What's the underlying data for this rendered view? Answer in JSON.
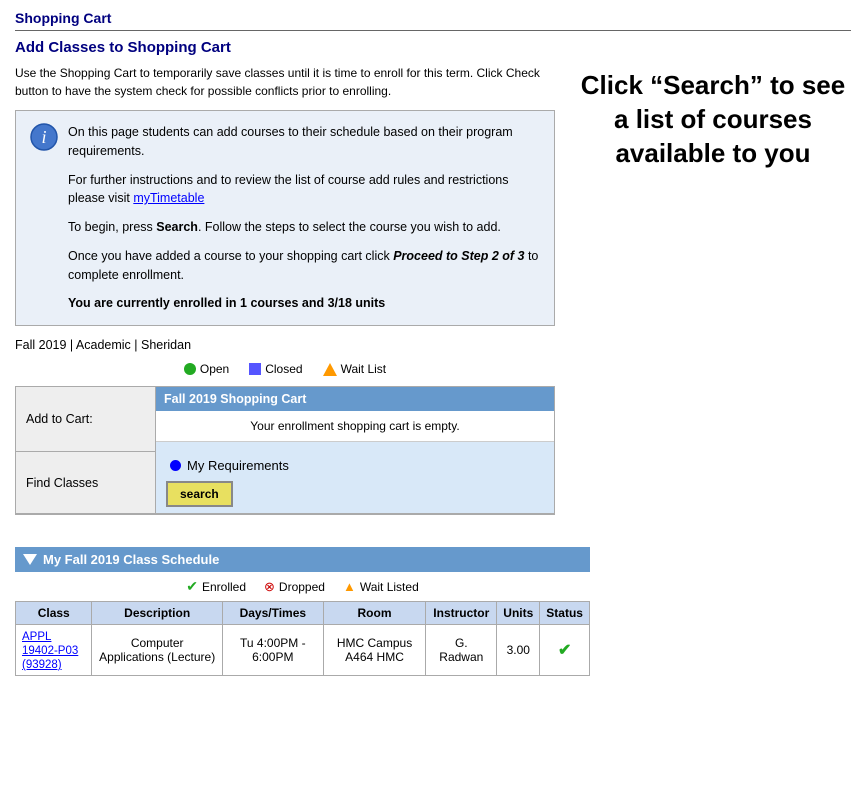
{
  "page": {
    "title": "Shopping Cart",
    "section_title": "Add Classes to Shopping Cart",
    "intro": "Use the Shopping Cart to temporarily save classes until it is time to enroll for this term.  Click Check button to have the system check for possible conflicts prior to enrolling.",
    "info_paragraphs": [
      "On this page students can add courses to their schedule based on their program requirements.",
      "For further instructions and to review the list of course add rules and restrictions please visit myTimetable",
      "To begin, press Search. Follow the steps to select the course you wish to add.",
      "Once you have added a course to your shopping cart click Proceed to Step 2 of 3 to complete enrollment.",
      "You are currently enrolled in 1 courses and 3/18 units"
    ],
    "my_timetable_link": "myTimetable",
    "callout_text": "Click “Search” to see a list of courses available to you"
  },
  "term": {
    "label": "Fall 2019 | Academic | Sheridan"
  },
  "legend": {
    "open_label": "Open",
    "closed_label": "Closed",
    "waitlist_label": "Wait List"
  },
  "cart": {
    "add_to_cart_label": "Add to Cart:",
    "find_classes_label": "Find Classes",
    "cart_title": "Fall 2019 Shopping Cart",
    "empty_message": "Your enrollment shopping cart is empty.",
    "my_requirements_label": "My Requirements",
    "search_button": "search"
  },
  "schedule": {
    "title": "My Fall 2019 Class Schedule",
    "legend": {
      "enrolled": "Enrolled",
      "dropped": "Dropped",
      "wait_listed": "Wait Listed"
    },
    "columns": [
      "Class",
      "Description",
      "Days/Times",
      "Room",
      "Instructor",
      "Units",
      "Status"
    ],
    "rows": [
      {
        "class_code": "APPL 19402-P03",
        "class_id": "93928",
        "description": "Computer Applications (Lecture)",
        "days_times": "Tu 4:00PM - 6:00PM",
        "room": "HMC Campus A464 HMC",
        "instructor": "G. Radwan",
        "units": "3.00",
        "status": "enrolled"
      }
    ]
  }
}
